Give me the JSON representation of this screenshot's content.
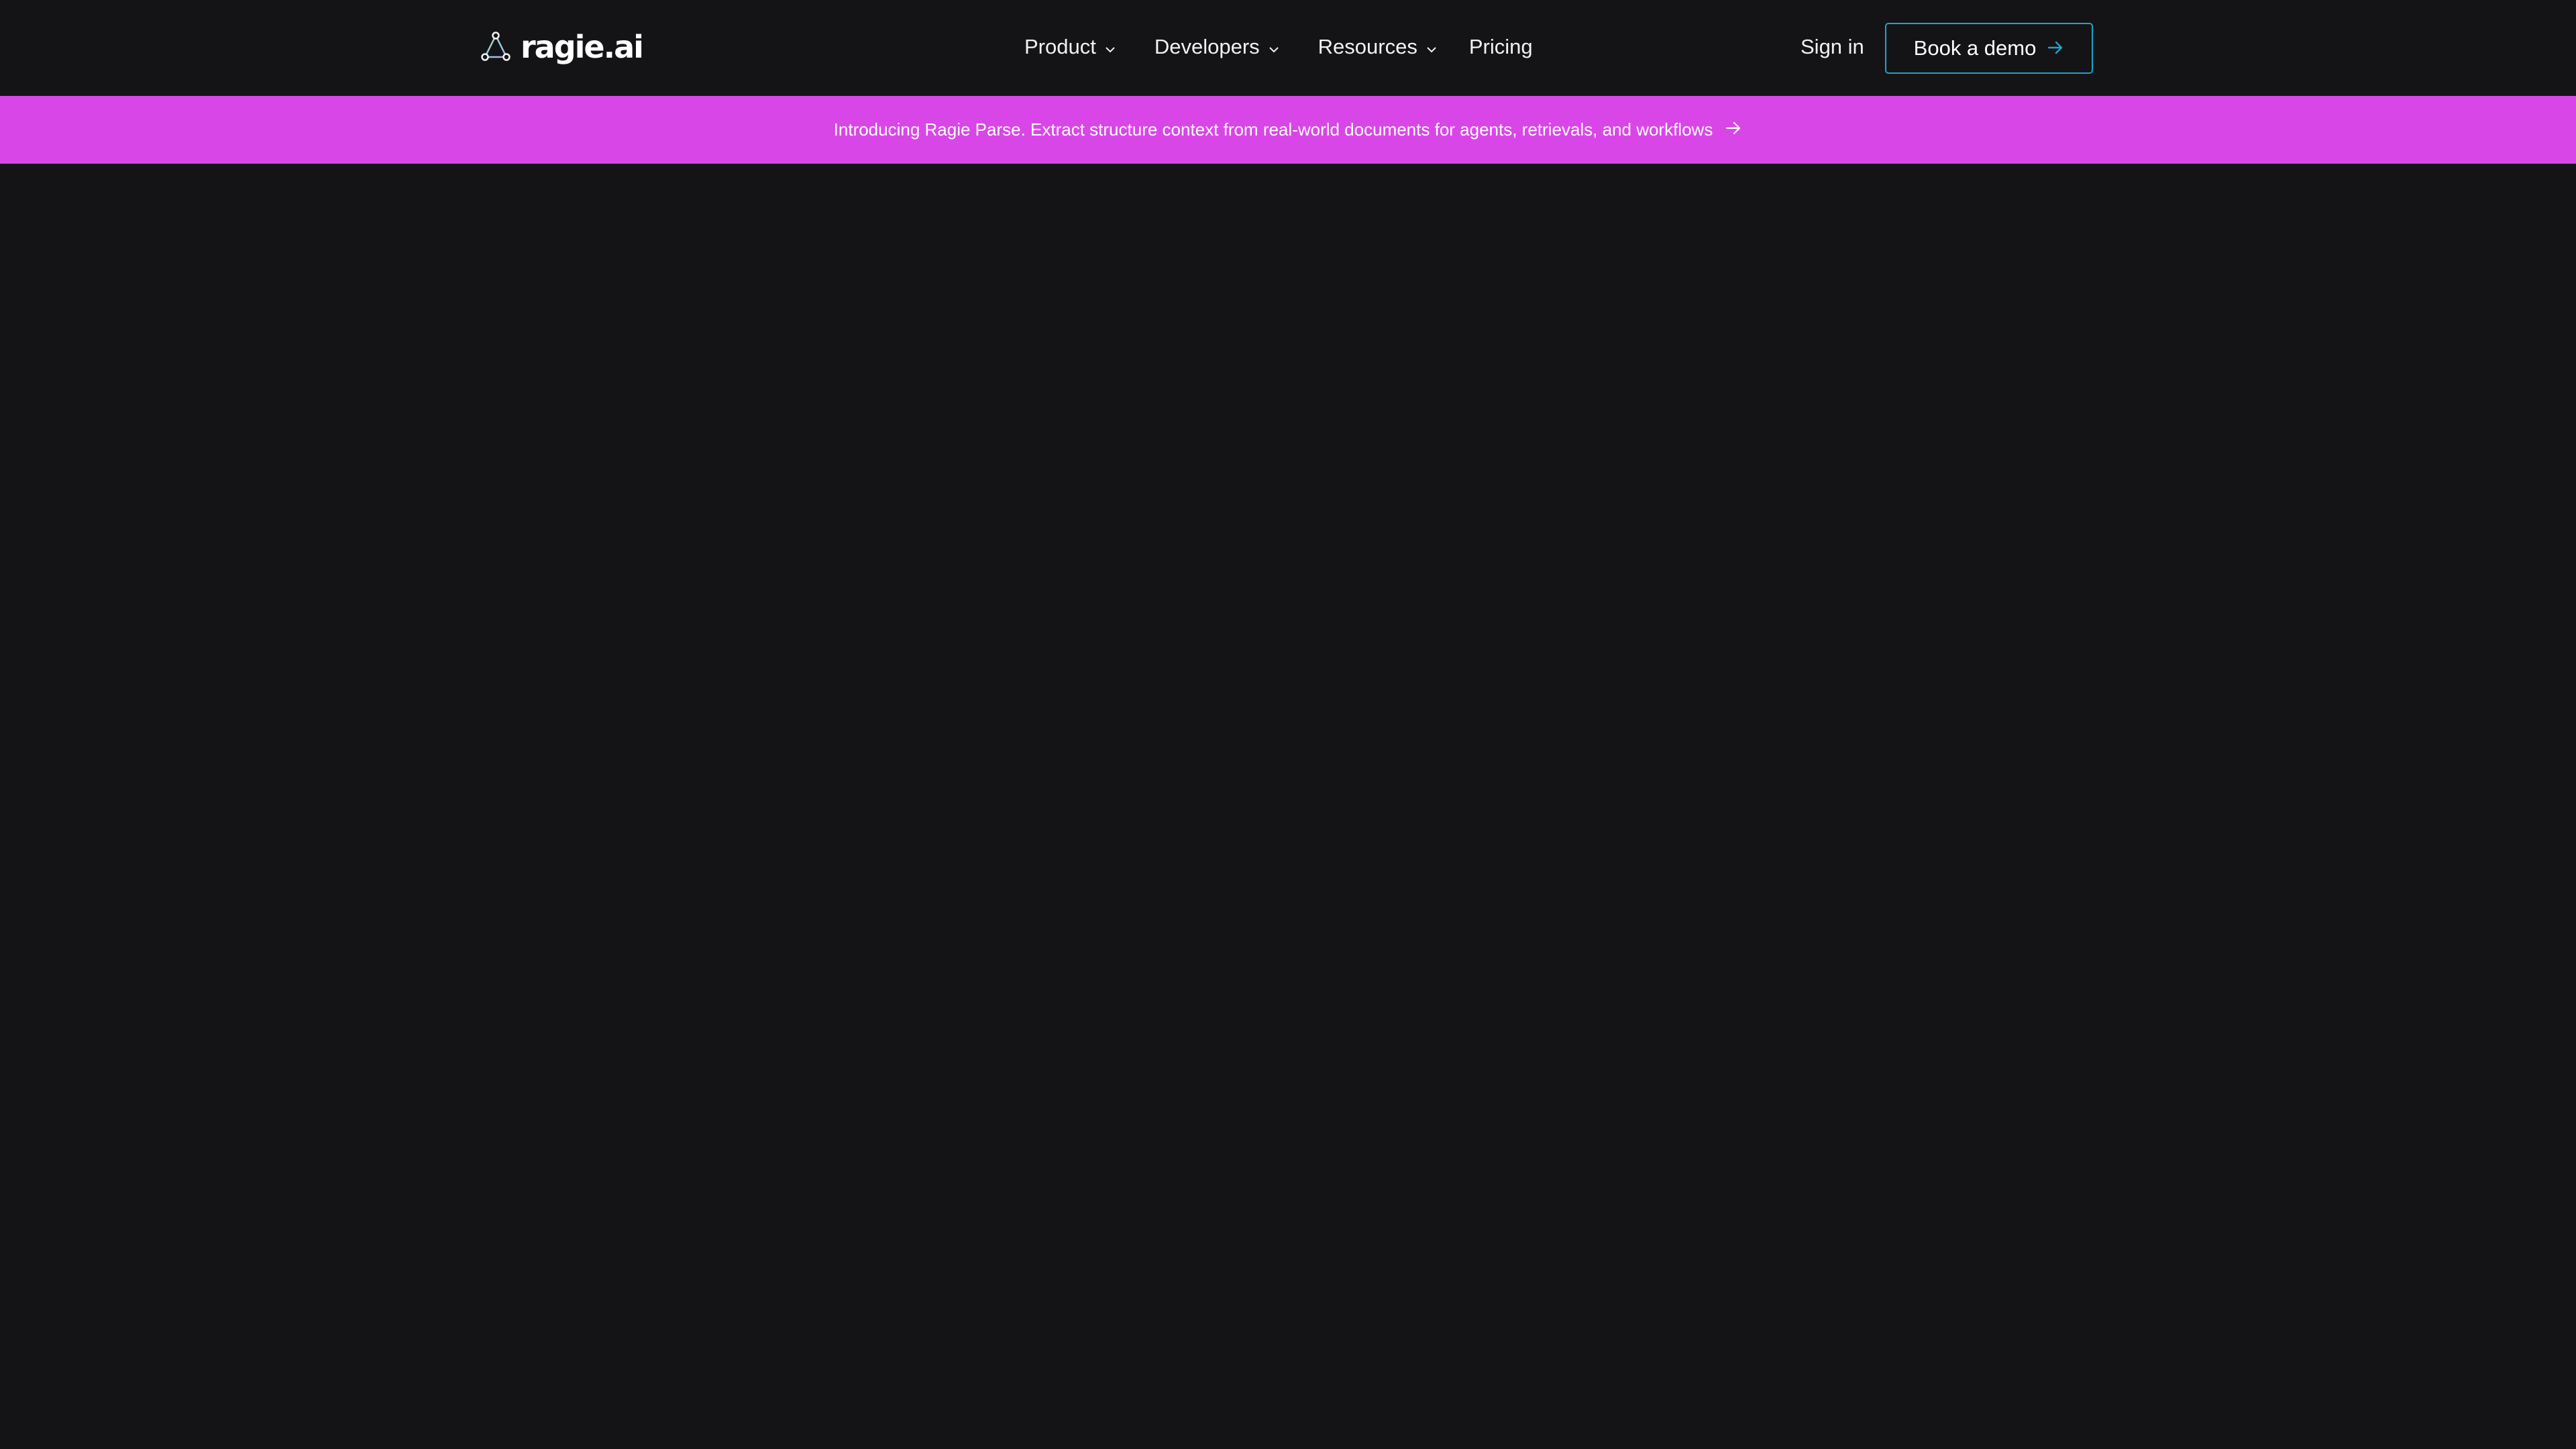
{
  "brand": {
    "name": "ragie.ai",
    "logo_icon": "triangle-nodes-icon"
  },
  "nav": {
    "items": [
      {
        "label": "Product",
        "has_dropdown": true
      },
      {
        "label": "Developers",
        "has_dropdown": true
      },
      {
        "label": "Resources",
        "has_dropdown": true
      },
      {
        "label": "Pricing",
        "has_dropdown": false
      }
    ],
    "sign_in": "Sign in",
    "cta": "Book a demo"
  },
  "banner": {
    "text": "Introducing Ragie Parse. Extract structure context from real-world documents for agents, retrievals, and workflows"
  },
  "colors": {
    "background": "#141416",
    "banner": "#d946e8",
    "cta_border": "#1fa3c8",
    "text": "#f2f2f2"
  }
}
